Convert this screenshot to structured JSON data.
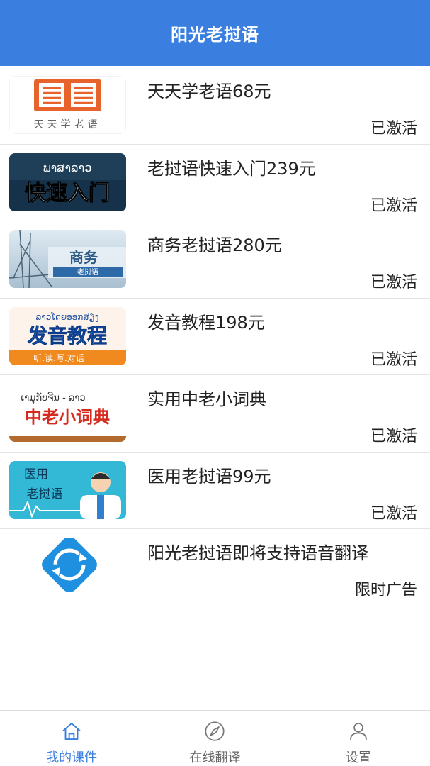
{
  "header": {
    "title": "阳光老挝语"
  },
  "courses": [
    {
      "name": "天天学老语68元",
      "status": "已激活",
      "thumb_text": "天天学老语",
      "thumb_icon": "book-icon"
    },
    {
      "name": "老挝语快速入门239元",
      "status": "已激活",
      "thumb_lao": "ພາສາລາວ",
      "thumb_text": "快速入门"
    },
    {
      "name": "商务老挝语280元",
      "status": "已激活",
      "thumb_text": "商务",
      "thumb_sub": "老挝语"
    },
    {
      "name": "发音教程198元",
      "status": "已激活",
      "thumb_lao": "ລາວໂດຍອອກສຽງ",
      "thumb_text": "发音教程",
      "thumb_sub": "听.读.写.对话"
    },
    {
      "name": "实用中老小词典",
      "status": "已激活",
      "thumb_lao": "ເາມຸກັບຈີນ - ລາວ",
      "thumb_text": "中老小词典"
    },
    {
      "name": "医用老挝语99元",
      "status": "已激活",
      "thumb_text": "医用",
      "thumb_sub": "老挝语",
      "thumb_icon": "doctor-icon"
    },
    {
      "name": "阳光老挝语即将支持语音翻译",
      "status": "限时广告",
      "thumb_icon": "refresh-icon"
    }
  ],
  "tabs": [
    {
      "label": "我的课件",
      "icon": "home-icon",
      "active": true
    },
    {
      "label": "在线翻译",
      "icon": "compass-icon",
      "active": false
    },
    {
      "label": "设置",
      "icon": "user-icon",
      "active": false
    }
  ],
  "colors": {
    "header": "#3a7ee0",
    "active_tab": "#3a7ee0",
    "inactive_tab": "#666666"
  }
}
